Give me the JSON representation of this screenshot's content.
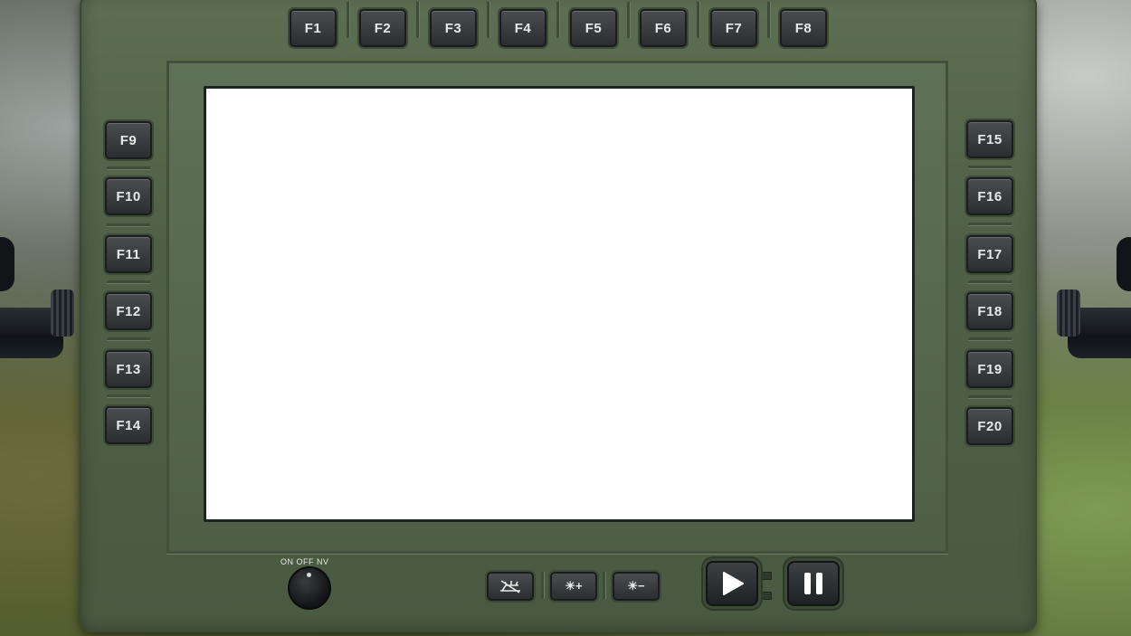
{
  "top_keys": [
    "F1",
    "F2",
    "F3",
    "F4",
    "F5",
    "F6",
    "F7",
    "F8"
  ],
  "left_keys": [
    "F9",
    "F10",
    "F11",
    "F12",
    "F13",
    "F14"
  ],
  "right_keys": [
    "F15",
    "F16",
    "F17",
    "F18",
    "F19",
    "F20"
  ],
  "power_knob": {
    "label": "ON OFF NV"
  },
  "controls": {
    "display_off_icon": "display-off-icon",
    "brightness_up_label": "☀+",
    "brightness_down_label": "☀−",
    "play_icon": "play-icon",
    "pause_icon": "pause-icon"
  },
  "colors": {
    "bezel": "#4f6046",
    "screen": "#ffffff",
    "key": "#2b2e31",
    "key_text": "#e8e8e8"
  }
}
